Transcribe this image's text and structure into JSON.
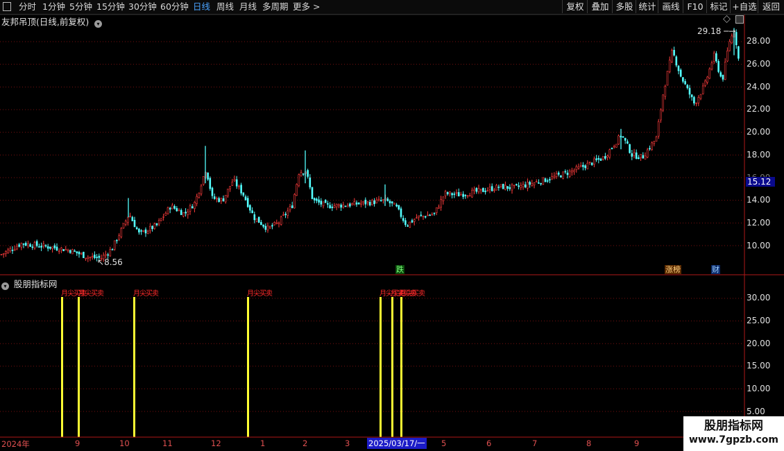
{
  "toolbar": {
    "left": [
      "分时",
      "1分钟",
      "5分钟",
      "15分钟",
      "30分钟",
      "60分钟",
      "日线",
      "周线",
      "月线",
      "多周期",
      "更多 >"
    ],
    "active": "日线",
    "right": [
      "复权",
      "叠加",
      "多股",
      "统计",
      "画线",
      "F10",
      "标记",
      "+自选",
      "返回"
    ]
  },
  "main_panel": {
    "title": "友邦吊顶(日线,前复权)",
    "price_ticks": [
      "28.00",
      "26.00",
      "24.00",
      "22.00",
      "20.00",
      "18.00",
      "16.00",
      "14.00",
      "12.00",
      "10.00"
    ],
    "current_price": "15.12",
    "high_label": "29.18",
    "low_label": "8.56",
    "tags": {
      "down": "跌",
      "limit_board": "涨榜",
      "finance": "财"
    }
  },
  "indicator_panel": {
    "title": "股朋指标网",
    "ticks": [
      "30.00",
      "25.00",
      "20.00",
      "15.00",
      "10.00",
      "5.00"
    ],
    "signal_text": "月尖买卖",
    "signal_bars": 7
  },
  "xaxis": {
    "labels": [
      "2024年",
      "9",
      "10",
      "11",
      "12",
      "1",
      "2",
      "3",
      "2025/03/17/一",
      "5",
      "6",
      "7",
      "8",
      "9"
    ]
  },
  "watermark": {
    "title": "股朋指标网",
    "url": "www.7gpzb.com"
  },
  "colors": {
    "up": "#ff3c3c",
    "down": "#54ffff",
    "signal": "#ffff33",
    "grid": "#7a1010",
    "axis": "#b01818"
  }
}
